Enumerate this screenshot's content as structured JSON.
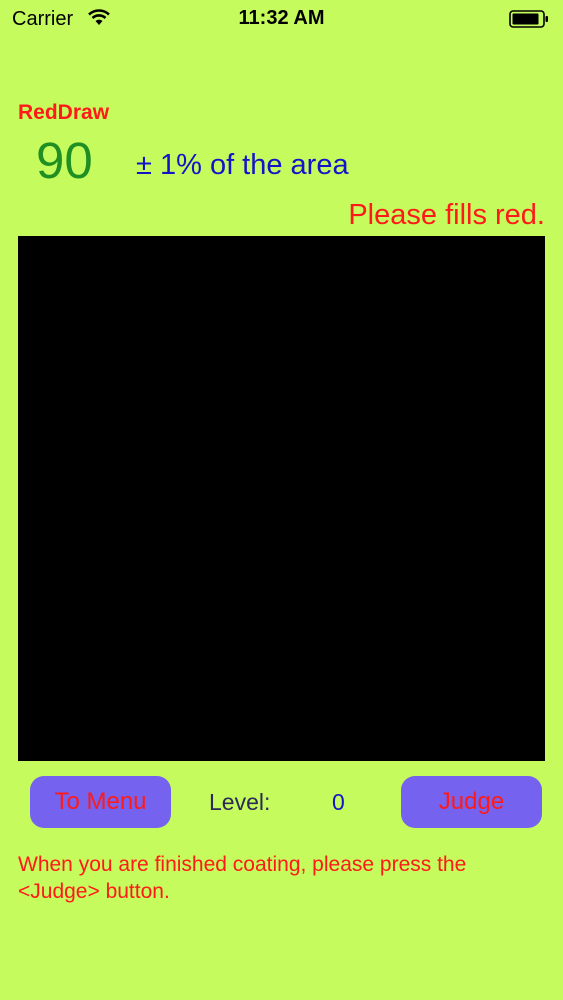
{
  "status_bar": {
    "carrier": "Carrier",
    "time": "11:32 AM",
    "wifi_icon": "wifi-icon",
    "battery_icon": "battery-icon"
  },
  "app": {
    "name": "RedDraw",
    "target_value": "90",
    "tolerance": "± 1% of the area",
    "instruction": "Please fills red."
  },
  "controls": {
    "menu_label": "To Menu",
    "level_label": "Level:",
    "level_value": "0",
    "judge_label": "Judge"
  },
  "hint": "When you are finished coating, please press the <Judge> button.",
  "colors": {
    "background": "#c5fb5c",
    "canvas": "#000000",
    "accent_red": "#ff1a1a",
    "target_green": "#1f8f23",
    "blue": "#1414c8",
    "button": "#7563f0"
  }
}
